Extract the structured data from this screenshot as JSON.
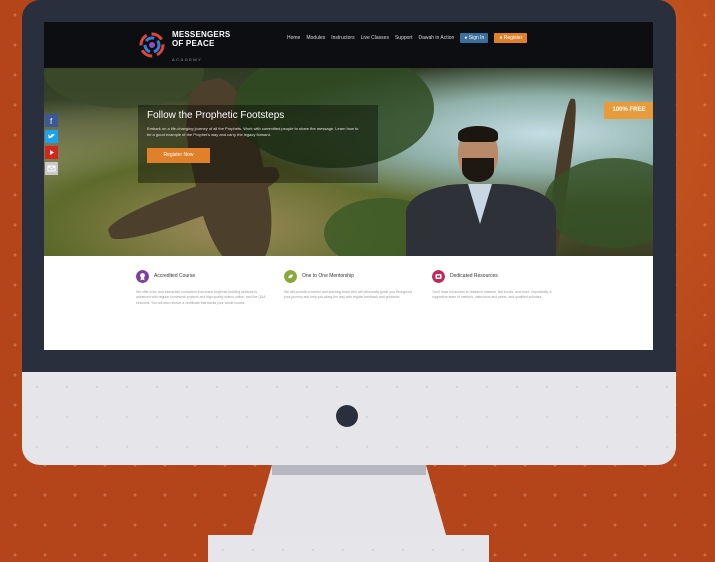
{
  "site": {
    "logo_line1": "MESSENGERS",
    "logo_line2": "OF PEACE",
    "logo_sub": "ACADEMY"
  },
  "nav": {
    "items": [
      "Home",
      "Modules",
      "Instructors",
      "Live Classes",
      "Support",
      "Dawah in Action"
    ],
    "signin_label": "Sign In",
    "register_label": "Register"
  },
  "hero": {
    "title": "Follow the Prophetic Footsteps",
    "description": "Embark on a life-changing journey of all the Prophets. Work with committed people to share the message. Learn how to be a good example of the Prophet's way and carry the legacy forward.",
    "button_label": "Register Now",
    "badge": "100% FREE"
  },
  "social": {
    "icons": [
      "facebook-icon",
      "twitter-icon",
      "youtube-icon",
      "email-icon"
    ],
    "colors": [
      "#3b5998",
      "#1da1f2",
      "#d2261e",
      "#c9c9cc"
    ]
  },
  "features": [
    {
      "title": "Accredited Course",
      "description": "We offer a fun and interactive curriculum from basic beginner building sections to advanced with regular homework projects and high quality videos online, and live Q&A sessions. You will also receive a certificate that backs your whole course.",
      "color": "#7b3fa0"
    },
    {
      "title": "One to One Mentorship",
      "description": "We will provide a mentor and teaching team who will personally guide you throughout your journey and help you along the way with regular feedback and guidance.",
      "color": "#8aa73a"
    },
    {
      "title": "Dedicated Resources",
      "description": "You'll have full access to research material, text books, and more. Importantly, a supportive team of mentors, instructors and peers, and qualified scholars.",
      "color": "#c2285a"
    }
  ]
}
